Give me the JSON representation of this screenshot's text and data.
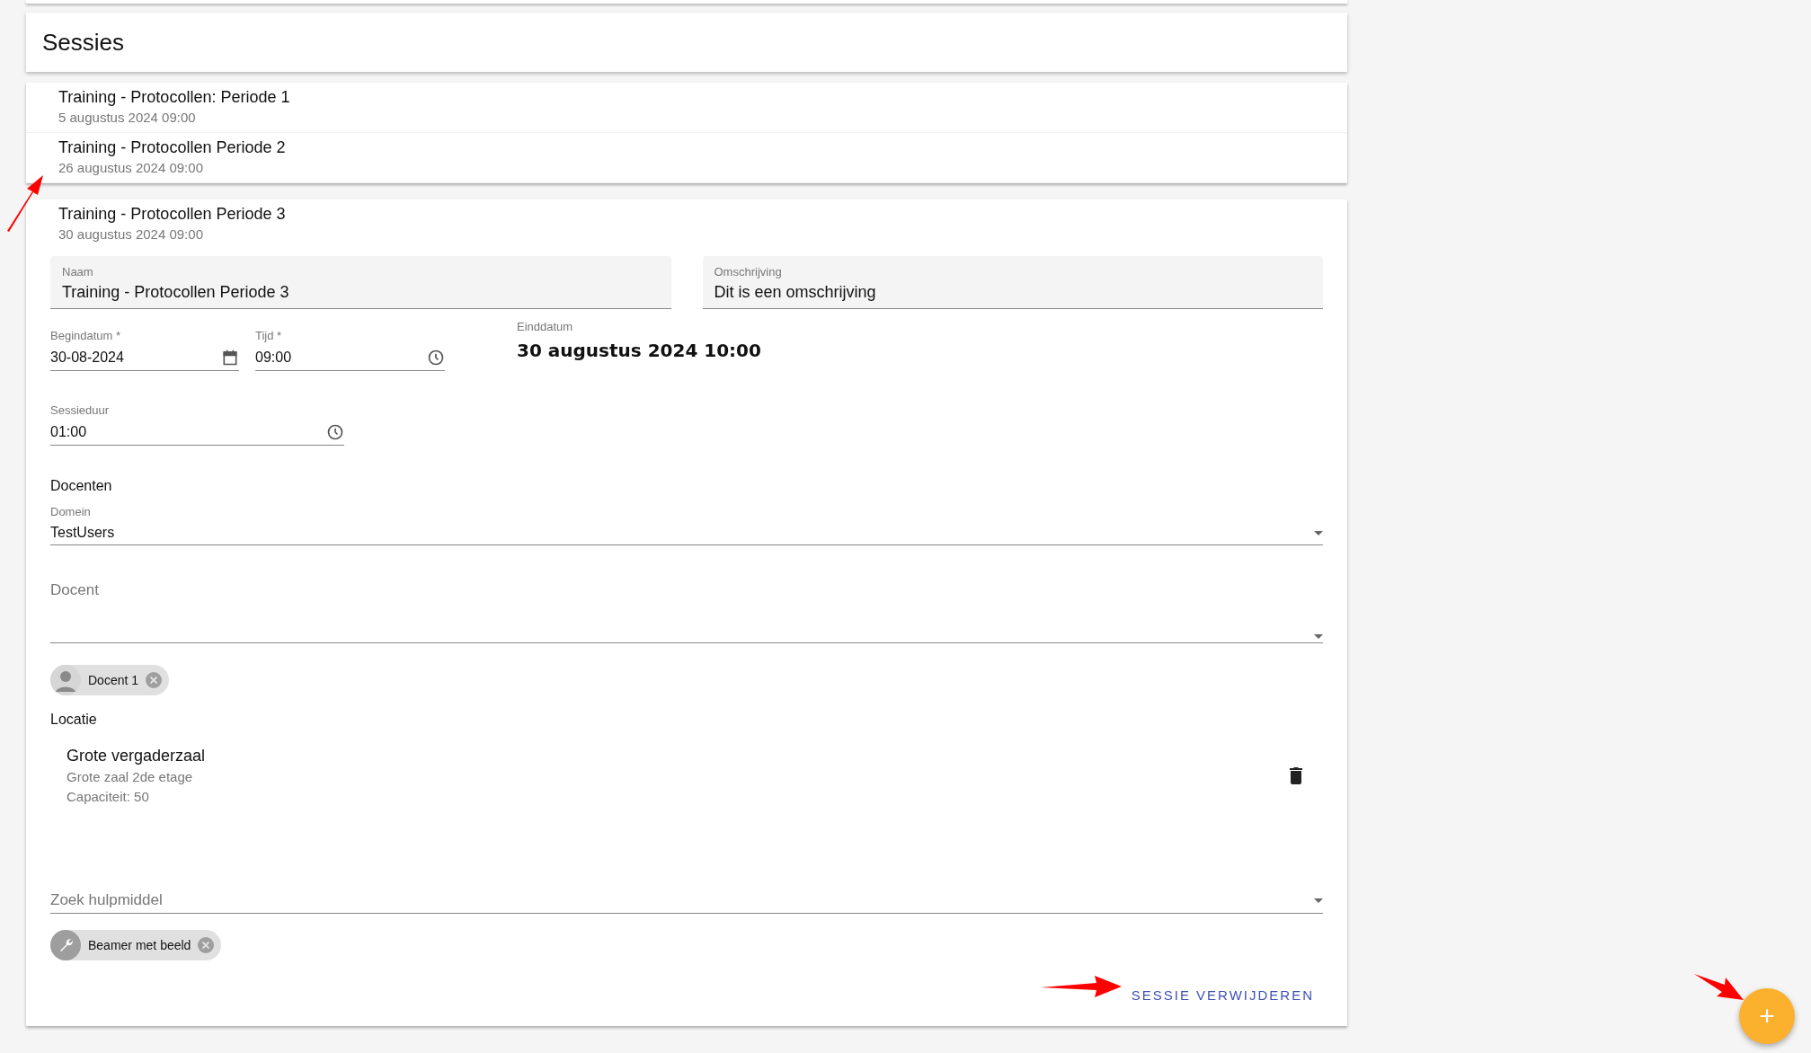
{
  "header": {
    "title": "Sessies"
  },
  "collapsed_sessions": [
    {
      "title": "Training - Protocollen: Periode 1",
      "date": "5 augustus 2024 09:00"
    },
    {
      "title": "Training - Protocollen Periode 2",
      "date": "26 augustus 2024 09:00"
    }
  ],
  "expanded_session": {
    "title": "Training - Protocollen Periode 3",
    "date": "30 augustus 2024 09:00",
    "naam": {
      "label": "Naam",
      "value": "Training - Protocollen Periode 3"
    },
    "omschrijving": {
      "label": "Omschrijving",
      "value": "Dit is een omschrijving"
    },
    "begindatum": {
      "label": "Begindatum *",
      "value": "30-08-2024"
    },
    "tijd": {
      "label": "Tijd *",
      "value": "09:00"
    },
    "einddatum": {
      "label": "Einddatum",
      "value": "30 augustus 2024 10:00"
    },
    "sessieduur": {
      "label": "Sessieduur",
      "value": "01:00"
    },
    "docenten_heading": "Docenten",
    "domein": {
      "label": "Domein",
      "value": "TestUsers"
    },
    "docent": {
      "placeholder": "Docent"
    },
    "docent_chips": [
      {
        "label": "Docent 1"
      }
    ],
    "locatie_heading": "Locatie",
    "location": {
      "name": "Grote vergaderzaal",
      "description": "Grote zaal 2de etage",
      "capacity": "Capaciteit: 50"
    },
    "hulpmiddel": {
      "placeholder": "Zoek hulpmiddel"
    },
    "hulpmiddel_chips": [
      {
        "label": "Beamer met beeld"
      }
    ],
    "delete_button": "SESSIE VERWIJDEREN"
  },
  "fab": {
    "label": "+"
  }
}
